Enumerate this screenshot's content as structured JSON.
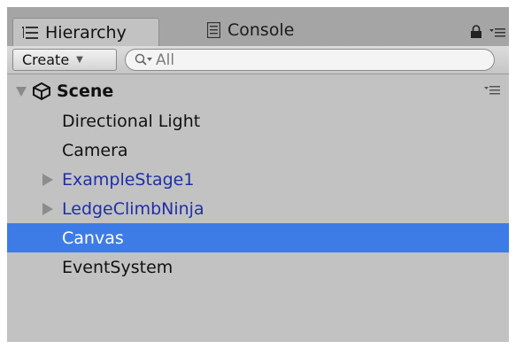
{
  "tabs": [
    {
      "label": "Hierarchy",
      "icon": "hierarchy-list-icon",
      "active": true
    },
    {
      "label": "Console",
      "icon": "console-icon",
      "active": false
    }
  ],
  "tabbar_icons": [
    "lock-icon",
    "tab-menu-icon"
  ],
  "toolbar": {
    "create_label": "Create",
    "search_placeholder": "All"
  },
  "scene": {
    "label": "Scene",
    "icon": "unity-logo-icon"
  },
  "items": [
    {
      "label": "Directional Light",
      "type": "object",
      "selected": false
    },
    {
      "label": "Camera",
      "type": "object",
      "selected": false
    },
    {
      "label": "ExampleStage1",
      "type": "prefab",
      "expandable": true,
      "selected": false
    },
    {
      "label": "LedgeClimbNinja",
      "type": "prefab",
      "expandable": true,
      "selected": false
    },
    {
      "label": "Canvas",
      "type": "object",
      "selected": true
    },
    {
      "label": "EventSystem",
      "type": "object",
      "selected": false
    }
  ],
  "colors": {
    "panel_bg": "#c2c2c2",
    "tabbar_bg": "#a5a5a5",
    "selection": "#3d7ce6",
    "prefab_text": "#1f2fa6"
  }
}
